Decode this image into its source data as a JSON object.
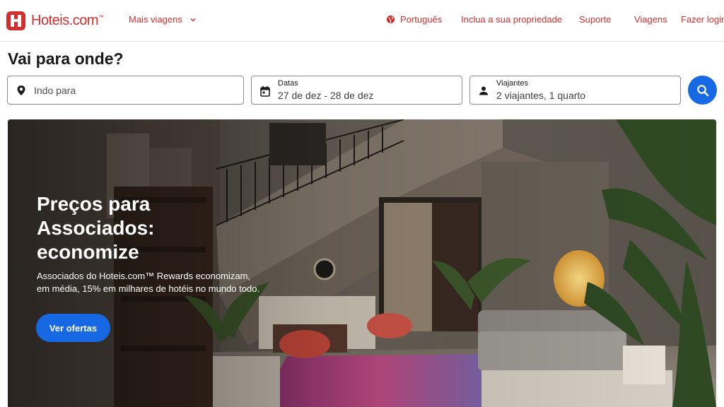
{
  "header": {
    "logo_text": "Hoteis.com",
    "logo_tm": "™",
    "more_trips": "Mais viagens",
    "language": "Português",
    "list_property": "Inclua a sua propriedade",
    "support": "Suporte",
    "trips": "Viagens",
    "login": "Fazer login"
  },
  "search": {
    "title": "Vai para onde?",
    "destination_placeholder": "Indo para",
    "dates_label": "Datas",
    "dates_value": "27 de dez - 28 de dez",
    "travelers_label": "Viajantes",
    "travelers_value": "2 viajantes, 1 quarto"
  },
  "hero": {
    "title": "Preços para Associados: economize",
    "description": "Associados do Hoteis.com™ Rewards economizam, em média, 15% em milhares de hotéis no mundo todo.",
    "cta": "Ver ofertas"
  },
  "colors": {
    "brand_red": "#d32f2f",
    "primary_blue": "#1668e3"
  },
  "icons": {
    "logo": "hotel-h-icon",
    "more": "chevron-down-icon",
    "language": "globe-icon",
    "destination": "map-pin-icon",
    "dates": "calendar-icon",
    "travelers": "person-icon",
    "search": "search-icon"
  }
}
